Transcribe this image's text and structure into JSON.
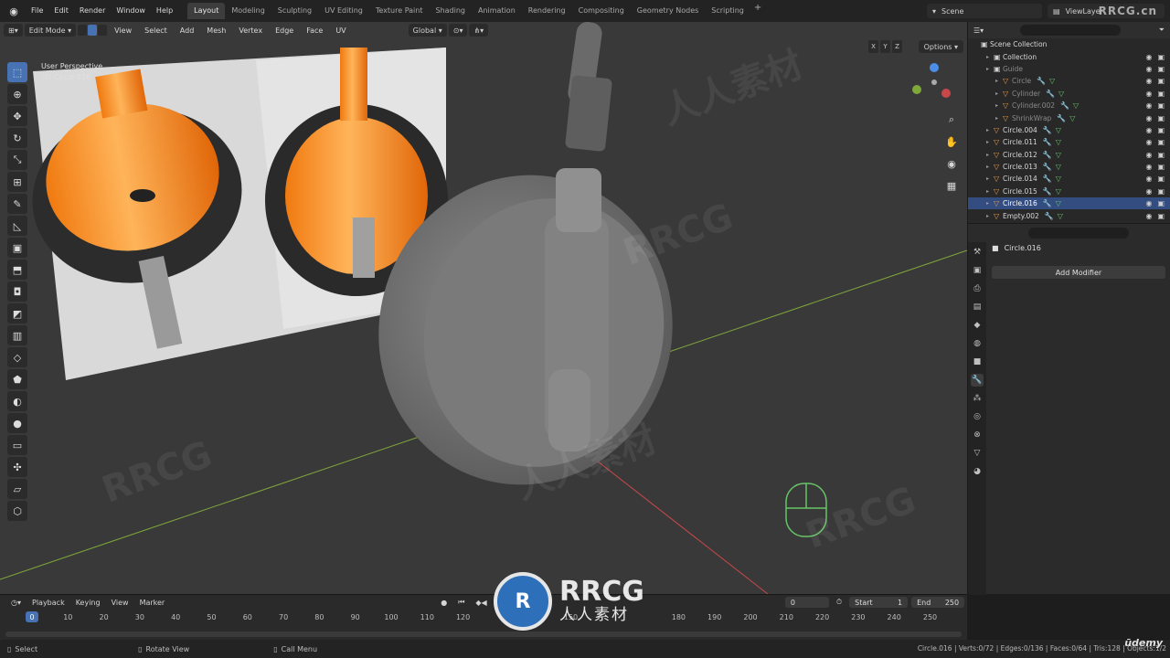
{
  "topbar": {
    "menus": [
      "File",
      "Edit",
      "Render",
      "Window",
      "Help"
    ],
    "workspaces": [
      "Layout",
      "Modeling",
      "Sculpting",
      "UV Editing",
      "Texture Paint",
      "Shading",
      "Animation",
      "Rendering",
      "Compositing",
      "Geometry Nodes",
      "Scripting"
    ],
    "active_workspace": "Layout",
    "scene": "Scene",
    "view_layer": "ViewLayer",
    "watermark": "RRCG.cn"
  },
  "viewport": {
    "mode": "Edit Mode",
    "menus": [
      "View",
      "Select",
      "Add",
      "Mesh",
      "Vertex",
      "Edge",
      "Face",
      "UV"
    ],
    "orientation": "Global",
    "axes": [
      "X",
      "Y",
      "Z"
    ],
    "options": "Options",
    "perspective": "User Perspective",
    "object_info": "(0) Circle.016"
  },
  "outliner": {
    "root": "Scene Collection",
    "rows": [
      {
        "name": "Collection",
        "dim": false,
        "level": 1,
        "type": "collection"
      },
      {
        "name": "Guide",
        "dim": true,
        "level": 1,
        "type": "collection"
      },
      {
        "name": "Circle",
        "dim": true,
        "level": 2,
        "type": "object"
      },
      {
        "name": "Cylinder",
        "dim": true,
        "level": 2,
        "type": "object"
      },
      {
        "name": "Cylinder.002",
        "dim": true,
        "level": 2,
        "type": "object"
      },
      {
        "name": "ShrinkWrap",
        "dim": true,
        "level": 2,
        "type": "object"
      },
      {
        "name": "Circle.004",
        "dim": false,
        "level": 1,
        "type": "object"
      },
      {
        "name": "Circle.011",
        "dim": false,
        "level": 1,
        "type": "object"
      },
      {
        "name": "Circle.012",
        "dim": false,
        "level": 1,
        "type": "object"
      },
      {
        "name": "Circle.013",
        "dim": false,
        "level": 1,
        "type": "object"
      },
      {
        "name": "Circle.014",
        "dim": false,
        "level": 1,
        "type": "object"
      },
      {
        "name": "Circle.015",
        "dim": false,
        "level": 1,
        "type": "object"
      },
      {
        "name": "Circle.016",
        "dim": false,
        "level": 1,
        "type": "object",
        "selected": true
      },
      {
        "name": "Empty.002",
        "dim": false,
        "level": 1,
        "type": "object"
      }
    ]
  },
  "properties": {
    "object_name": "Circle.016",
    "add_modifier": "Add Modifier"
  },
  "timeline": {
    "menus": [
      "Playback",
      "Keying",
      "View",
      "Marker"
    ],
    "current_frame": "0",
    "start_label": "Start",
    "start": "1",
    "end_label": "End",
    "end": "250",
    "ruler": [
      "0",
      "10",
      "20",
      "30",
      "40",
      "50",
      "60",
      "70",
      "80",
      "90",
      "100",
      "110",
      "120",
      "150",
      "180",
      "190",
      "200",
      "210",
      "220",
      "230",
      "240",
      "250"
    ]
  },
  "statusbar": {
    "select": "Select",
    "rotate": "Rotate View",
    "call_menu": "Call Menu",
    "stats": "Circle.016 | Verts:0/72 | Edges:0/136 | Faces:0/64 | Tris:128 | Objects:1/2",
    "brand": "ūdemy"
  },
  "overlay": {
    "rrcg": "RRCG",
    "rrcg_sub": "人人素材"
  },
  "colors": {
    "accent": "#4772b3",
    "selection_row": "#334d80",
    "object_icon": "#e89a47",
    "mesh_icon": "#66c466",
    "modifier_icon": "#7fa7e6",
    "x_axis": "#c8484a",
    "y_axis": "#7fa83a"
  }
}
